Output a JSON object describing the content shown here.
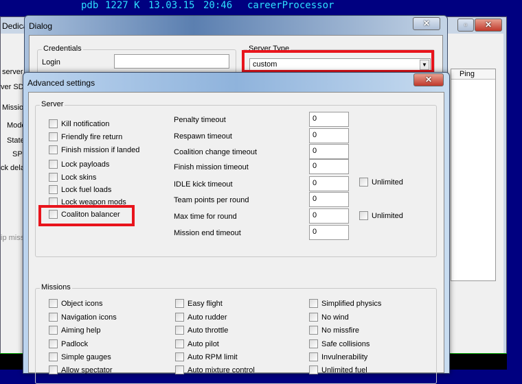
{
  "terminal": {
    "name": "pdb",
    "size": "1227 K",
    "date": "13.03.15",
    "time": "20:46",
    "process": "careerProcessor"
  },
  "background_window": {
    "title": "Dedica",
    "labels": [
      "server",
      "ver SDS",
      "Mission",
      "Mode",
      "State",
      "SPS",
      "ck delay",
      "ip miss"
    ],
    "column_ping": "Ping"
  },
  "dialog": {
    "title": "Dialog",
    "credentials_label": "Credentials",
    "login_label": "Login",
    "login_value": "",
    "server_type_label": "Server Type",
    "server_type_value": "custom"
  },
  "advanced": {
    "title": "Advanced settings",
    "server_group": "Server",
    "server_checks": [
      "Kill notification",
      "Friendly fire return",
      "Finish mission if landed",
      "Lock payloads",
      "Lock skins",
      "Lock fuel loads",
      "Lock weapon mods",
      "Coaliton balancer"
    ],
    "fields": [
      {
        "label": "Penalty timeout",
        "value": "0"
      },
      {
        "label": "Respawn timeout",
        "value": "0"
      },
      {
        "label": "Coalition change timeout",
        "value": "0"
      },
      {
        "label": "Finish mission timeout",
        "value": "0"
      },
      {
        "label": "IDLE kick timeout",
        "value": "0",
        "unlimited": "Unlimited"
      },
      {
        "label": "Team points per round",
        "value": "0"
      },
      {
        "label": "Max time for round",
        "value": "0",
        "unlimited": "Unlimited"
      },
      {
        "label": "Mission end timeout",
        "value": "0"
      }
    ],
    "missions_group": "Missions",
    "missions_col1": [
      "Object icons",
      "Navigation icons",
      "Aiming help",
      "Padlock",
      "Simple gauges",
      "Allow spectator"
    ],
    "missions_col2": [
      "Easy flight",
      "Auto rudder",
      "Auto throttle",
      "Auto pilot",
      "Auto RPM limit",
      "Auto mixture control"
    ],
    "missions_col3": [
      "Simplified physics",
      "No wind",
      "No missfire",
      "Safe collisions",
      "Invulnerability",
      "Unlimited fuel"
    ]
  },
  "colors": {
    "highlight": "#e8141c",
    "terminal_bg": "#000080",
    "terminal_text": "#2ee0ff"
  }
}
